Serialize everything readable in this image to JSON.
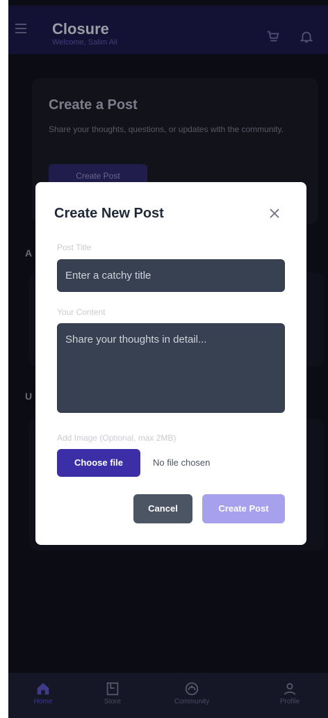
{
  "header": {
    "title": "Closure",
    "subtitle": "Welcome, Salim Ali"
  },
  "background": {
    "card_title": "Create a Post",
    "card_text": "Share your thoughts, questions, or updates with the community.",
    "card_button": "Create Post",
    "section_letter_1": "A",
    "section_letter_2": "U"
  },
  "modal": {
    "title": "Create New Post",
    "post_title_label": "Post Title",
    "post_title_placeholder": "Enter a catchy title",
    "content_label": "Your Content",
    "content_placeholder": "Share your thoughts in detail...",
    "image_label": "Add Image (Optional, max 2MB)",
    "choose_file": "Choose file",
    "no_file": "No file chosen",
    "cancel": "Cancel",
    "create": "Create Post"
  },
  "nav": {
    "items": [
      {
        "label": "Home",
        "icon": "home-icon"
      },
      {
        "label": "Store",
        "icon": "store-icon"
      },
      {
        "label": "Community",
        "icon": "community-icon"
      },
      {
        "label": "Profile",
        "icon": "profile-icon"
      }
    ]
  },
  "colors": {
    "accent": "#3b2ea7",
    "header_bg": "#1b1846",
    "app_bg": "#10111c"
  }
}
